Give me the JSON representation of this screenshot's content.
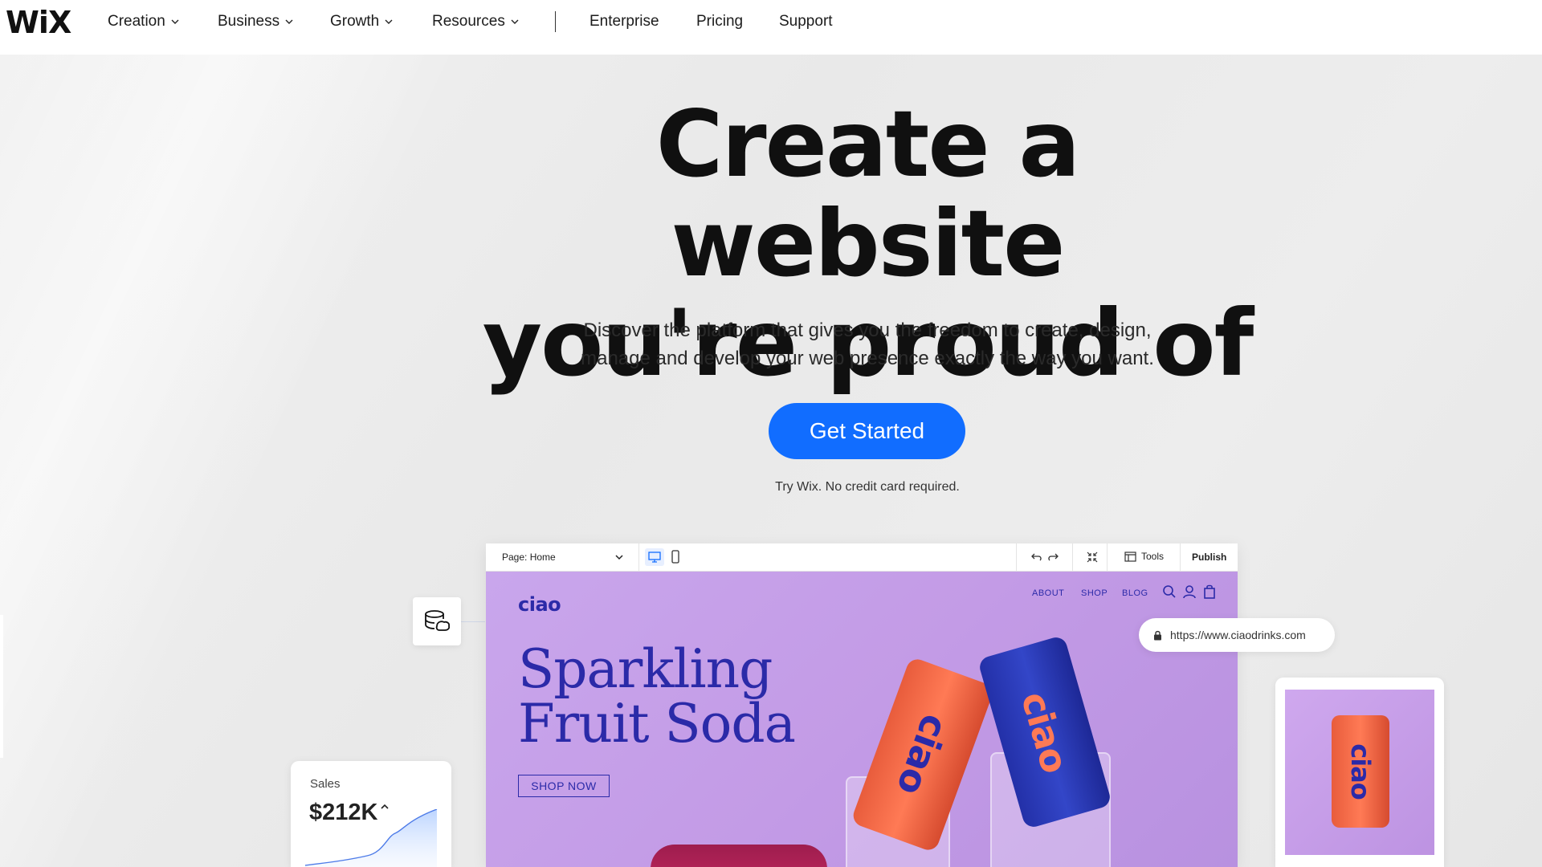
{
  "brand": {
    "logo": "WiX"
  },
  "nav": {
    "items": [
      {
        "label": "Creation",
        "dropdown": true
      },
      {
        "label": "Business",
        "dropdown": true
      },
      {
        "label": "Growth",
        "dropdown": true
      },
      {
        "label": "Resources",
        "dropdown": true
      },
      {
        "label": "Enterprise",
        "dropdown": false
      },
      {
        "label": "Pricing",
        "dropdown": false
      },
      {
        "label": "Support",
        "dropdown": false
      }
    ]
  },
  "hero": {
    "headline_line1": "Create a website",
    "headline_line2": "you're proud of",
    "subtext_line1": "Discover the platform that gives you the freedom to create, design,",
    "subtext_line2": "manage and develop your web presence exactly the way you want.",
    "cta_label": "Get Started",
    "cta_note": "Try Wix. No credit card required.",
    "accent_color": "#116dff"
  },
  "editor": {
    "page_selector": "Page: Home",
    "tools_label": "Tools",
    "publish_label": "Publish",
    "site": {
      "logo": "ciao",
      "nav": [
        "ABOUT",
        "SHOP",
        "BLOG"
      ],
      "title_line1": "Sparkling",
      "title_line2": "Fruit Soda",
      "shop_button": "SHOP NOW",
      "can_text": "ciao",
      "brand_color": "#2b2aa8"
    }
  },
  "widgets": {
    "url": "https://www.ciaodrinks.com",
    "sales_label": "Sales",
    "sales_value": "$212K"
  }
}
